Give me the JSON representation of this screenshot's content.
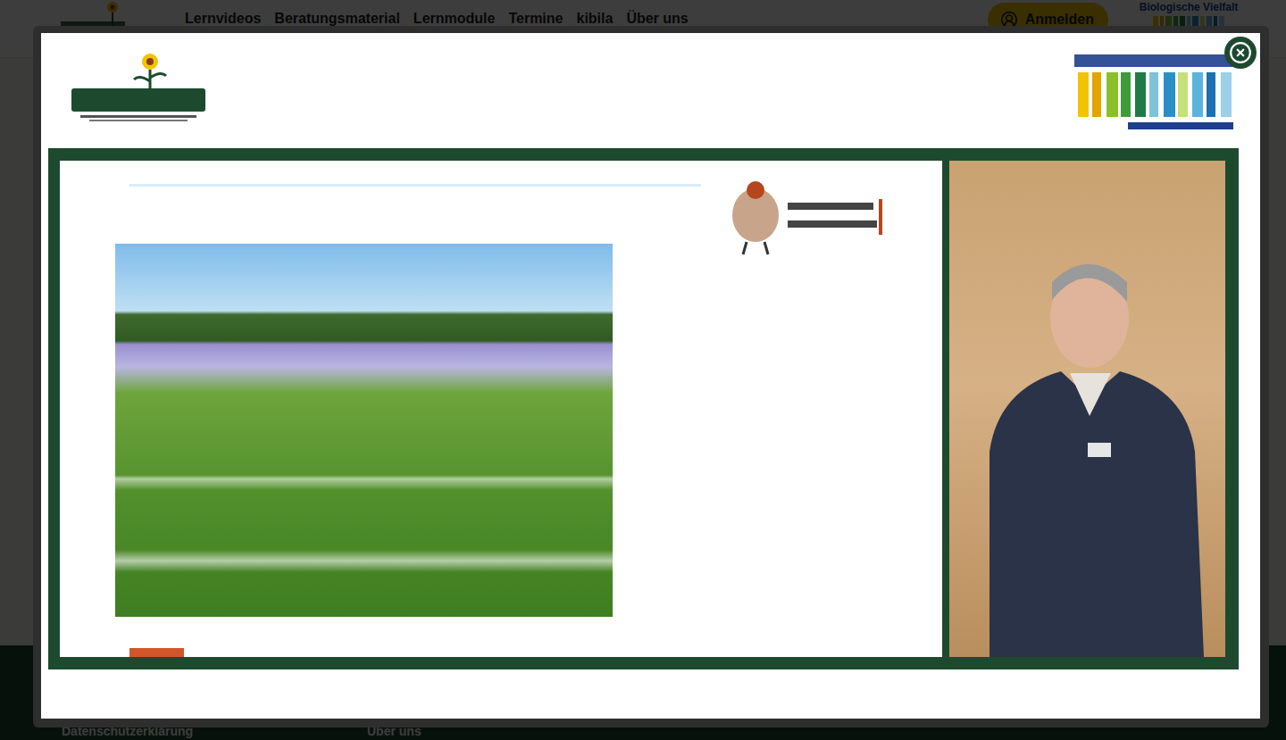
{
  "header": {
    "nav": [
      {
        "label": "Lernvideos"
      },
      {
        "label": "Beratungsmaterial"
      },
      {
        "label": "Lernmodule"
      },
      {
        "label": "Termine"
      },
      {
        "label": "kibila"
      },
      {
        "label": "Über uns"
      }
    ],
    "login": {
      "label": "Anmelden"
    },
    "partner_logo": {
      "label": "Biologische Vielfalt"
    }
  },
  "footer": {
    "links": [
      "Datenschutzerklärung",
      "Über uns"
    ]
  },
  "modal": {
    "open": true
  }
}
